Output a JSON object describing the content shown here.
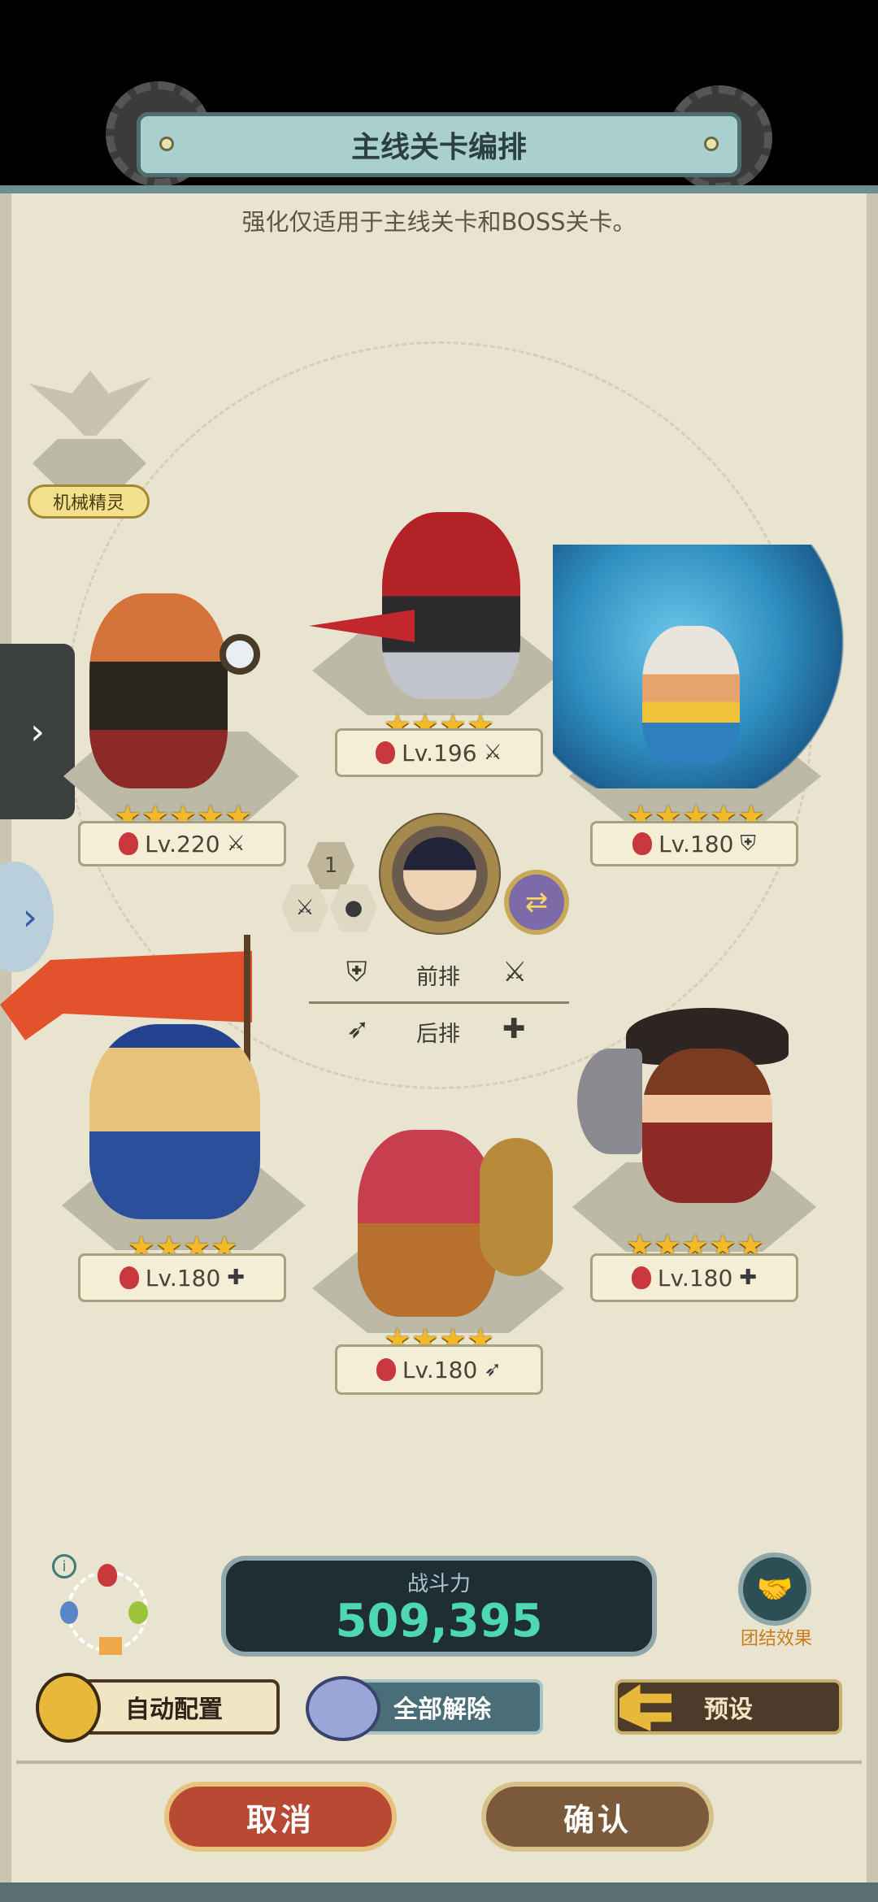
{
  "header": {
    "title": "主线关卡编排",
    "subtitle": "强化仅适用于主线关卡和BOSS关卡。"
  },
  "pet": {
    "label": "机械精灵"
  },
  "heroes": [
    {
      "id": "red-panda",
      "level": "Lv.220",
      "stars": "★★★★★",
      "role_icon": "⚔"
    },
    {
      "id": "red-hair",
      "level": "Lv.196",
      "stars": "★★★★",
      "role_icon": "⚔"
    },
    {
      "id": "dragon-girl",
      "level": "Lv.180",
      "stars": "★★★★★",
      "role_icon": "⛨"
    },
    {
      "id": "flag-girl",
      "level": "Lv.180",
      "stars": "★★★★",
      "role_icon": "✚"
    },
    {
      "id": "snake-girl",
      "level": "Lv.180",
      "stars": "★★★★",
      "role_icon": "➶"
    },
    {
      "id": "cowboy",
      "level": "Lv.180",
      "stars": "★★★★★",
      "role_icon": "✚"
    }
  ],
  "leader": {
    "slot_number": "1"
  },
  "formation": {
    "front_label": "前排",
    "back_label": "后排"
  },
  "power": {
    "label": "战斗力",
    "value": "509,395"
  },
  "team_effect": {
    "label": "团结效果"
  },
  "buttons": {
    "auto": "自动配置",
    "clear_all": "全部解除",
    "preset": "预设",
    "cancel": "取消",
    "confirm": "确认"
  },
  "colors": {
    "fire": "#c8383c",
    "star": "#f2b928",
    "power": "#4ed8b2",
    "cancel": "#b84a34",
    "confirm": "#7a5a3a"
  }
}
